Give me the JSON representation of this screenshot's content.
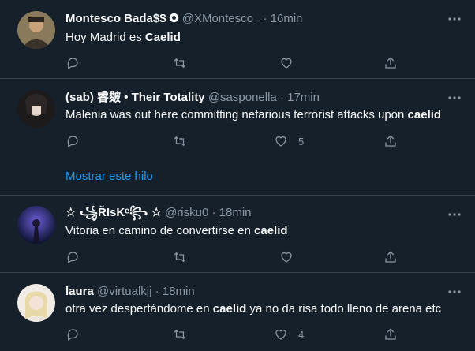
{
  "tweets": [
    {
      "name": "Montesco Bada$$",
      "handle": "@XMontesco_",
      "time": "16min",
      "text_before": "Hoy Madrid es ",
      "text_bold": "Caelid",
      "text_after": "",
      "likes": "",
      "verified_icon": "badge-icon"
    },
    {
      "name": "(sab) 睿皴 • Their Totality",
      "handle": "@sasponella",
      "time": "17min",
      "text_before": "Malenia was out here committing nefarious terrorist attacks upon ",
      "text_bold": "caelid",
      "text_after": "",
      "likes": "5",
      "show_thread": "Mostrar este hilo"
    },
    {
      "name": "☆ ꧁ŘIsKᵉ꧂ ☆",
      "handle": "@risku0",
      "time": "18min",
      "text_before": "Vitoria en camino de convertirse en ",
      "text_bold": "caelid",
      "text_after": "",
      "likes": ""
    },
    {
      "name": "laura",
      "handle": "@virtualkjj",
      "time": "18min",
      "text_before": "otra vez despertándome en ",
      "text_bold": "caelid",
      "text_after": " ya no da risa todo lleno de arena etc",
      "likes": "4"
    }
  ],
  "dot": "·",
  "icons": [
    "reply-icon",
    "retweet-icon",
    "like-icon",
    "share-icon",
    "more-icon"
  ],
  "colors": {
    "background": "#15202b",
    "border": "#38444d",
    "muted": "#8b98a5",
    "link": "#1d9bf0"
  }
}
